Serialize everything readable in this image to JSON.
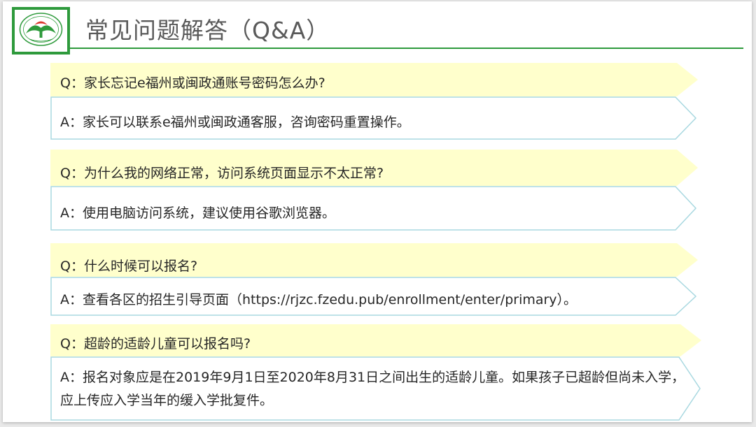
{
  "header": {
    "title": "常见问题解答（Q&A）",
    "logo_icon": "school-logo-icon"
  },
  "colors": {
    "accent_green": "#2e9a3c",
    "question_fill": "#ffffcc",
    "answer_border": "#a8d8e0"
  },
  "qa": [
    {
      "question": "Q：家长忘记e福州或闽政通账号密码怎么办?",
      "answer": "A：家长可以联系e福州或闽政通客服，咨询密码重置操作。"
    },
    {
      "question": "Q：为什么我的网络正常，访问系统页面显示不太正常?",
      "answer": "A：使用电脑访问系统，建议使用谷歌浏览器。"
    },
    {
      "question": "Q：什么时候可以报名?",
      "answer": "A：查看各区的招生引导页面（https://rjzc.fzedu.pub/enrollment/enter/primary）。"
    },
    {
      "question": "Q：超龄的适龄儿童可以报名吗?",
      "answer": "A：报名对象应是在2019年9月1日至2020年8月31日之间出生的适龄儿童。如果孩子已超龄但尚未入学，应上传应入学当年的缓入学批复件。"
    }
  ]
}
